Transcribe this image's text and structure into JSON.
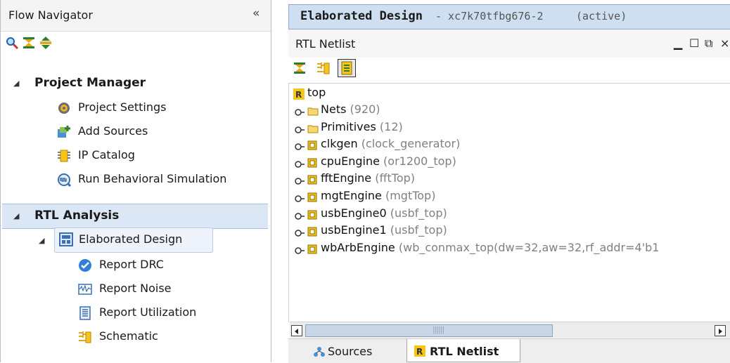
{
  "flow_navigator": {
    "title": "Flow Navigator",
    "collapse_glyph": "«",
    "toolbar_icons": [
      "search-icon",
      "collapse-all-icon",
      "expand-all-icon"
    ],
    "sections": [
      {
        "label": "Project Manager",
        "items": [
          {
            "label": "Project Settings",
            "icon": "gear-icon"
          },
          {
            "label": "Add Sources",
            "icon": "add-sources-icon"
          },
          {
            "label": "IP Catalog",
            "icon": "ip-catalog-icon"
          },
          {
            "label": "Run Behavioral Simulation",
            "icon": "simulation-icon"
          }
        ]
      },
      {
        "label": "RTL Analysis",
        "group": {
          "label": "Elaborated Design",
          "icon": "elaborated-design-icon",
          "items": [
            {
              "label": "Report DRC",
              "icon": "check-icon"
            },
            {
              "label": "Report Noise",
              "icon": "noise-icon"
            },
            {
              "label": "Report Utilization",
              "icon": "utilization-icon"
            },
            {
              "label": "Schematic",
              "icon": "schematic-icon"
            }
          ]
        }
      }
    ]
  },
  "design_tab": {
    "title": "Elaborated Design",
    "part": "- xc7k70tfbg676-2",
    "status": "(active)"
  },
  "netlist_panel": {
    "title": "RTL Netlist",
    "window_buttons": {
      "minimize": "▁",
      "maximize": "☐",
      "restore": "⧉",
      "close": "×"
    },
    "toolbar_icons": [
      "collapse-all-icon",
      "schematic-icon",
      "auto-update-icon"
    ],
    "tree": {
      "root": "top",
      "children": [
        {
          "name": "Nets",
          "extra": "(920)",
          "kind": "folder"
        },
        {
          "name": "Primitives",
          "extra": "(12)",
          "kind": "folder"
        },
        {
          "name": "clkgen",
          "extra": "(clock_generator)",
          "kind": "cell"
        },
        {
          "name": "cpuEngine",
          "extra": "(or1200_top)",
          "kind": "cell"
        },
        {
          "name": "fftEngine",
          "extra": "(fftTop)",
          "kind": "cell"
        },
        {
          "name": "mgtEngine",
          "extra": "(mgtTop)",
          "kind": "cell"
        },
        {
          "name": "usbEngine0",
          "extra": "(usbf_top)",
          "kind": "cell"
        },
        {
          "name": "usbEngine1",
          "extra": "(usbf_top)",
          "kind": "cell"
        },
        {
          "name": "wbArbEngine",
          "extra": "(wb_conmax_top(dw=32,aw=32,rf_addr=4'b1",
          "kind": "cell"
        }
      ]
    }
  },
  "bottom_tabs": [
    {
      "label": "Sources",
      "icon": "sources-icon",
      "active": false
    },
    {
      "label": "RTL Netlist",
      "icon": "rtl-netlist-icon",
      "active": true
    }
  ],
  "colors": {
    "selection": "#dce7f5",
    "tab_header": "#cfdff2",
    "secondary_text": "#808080"
  }
}
